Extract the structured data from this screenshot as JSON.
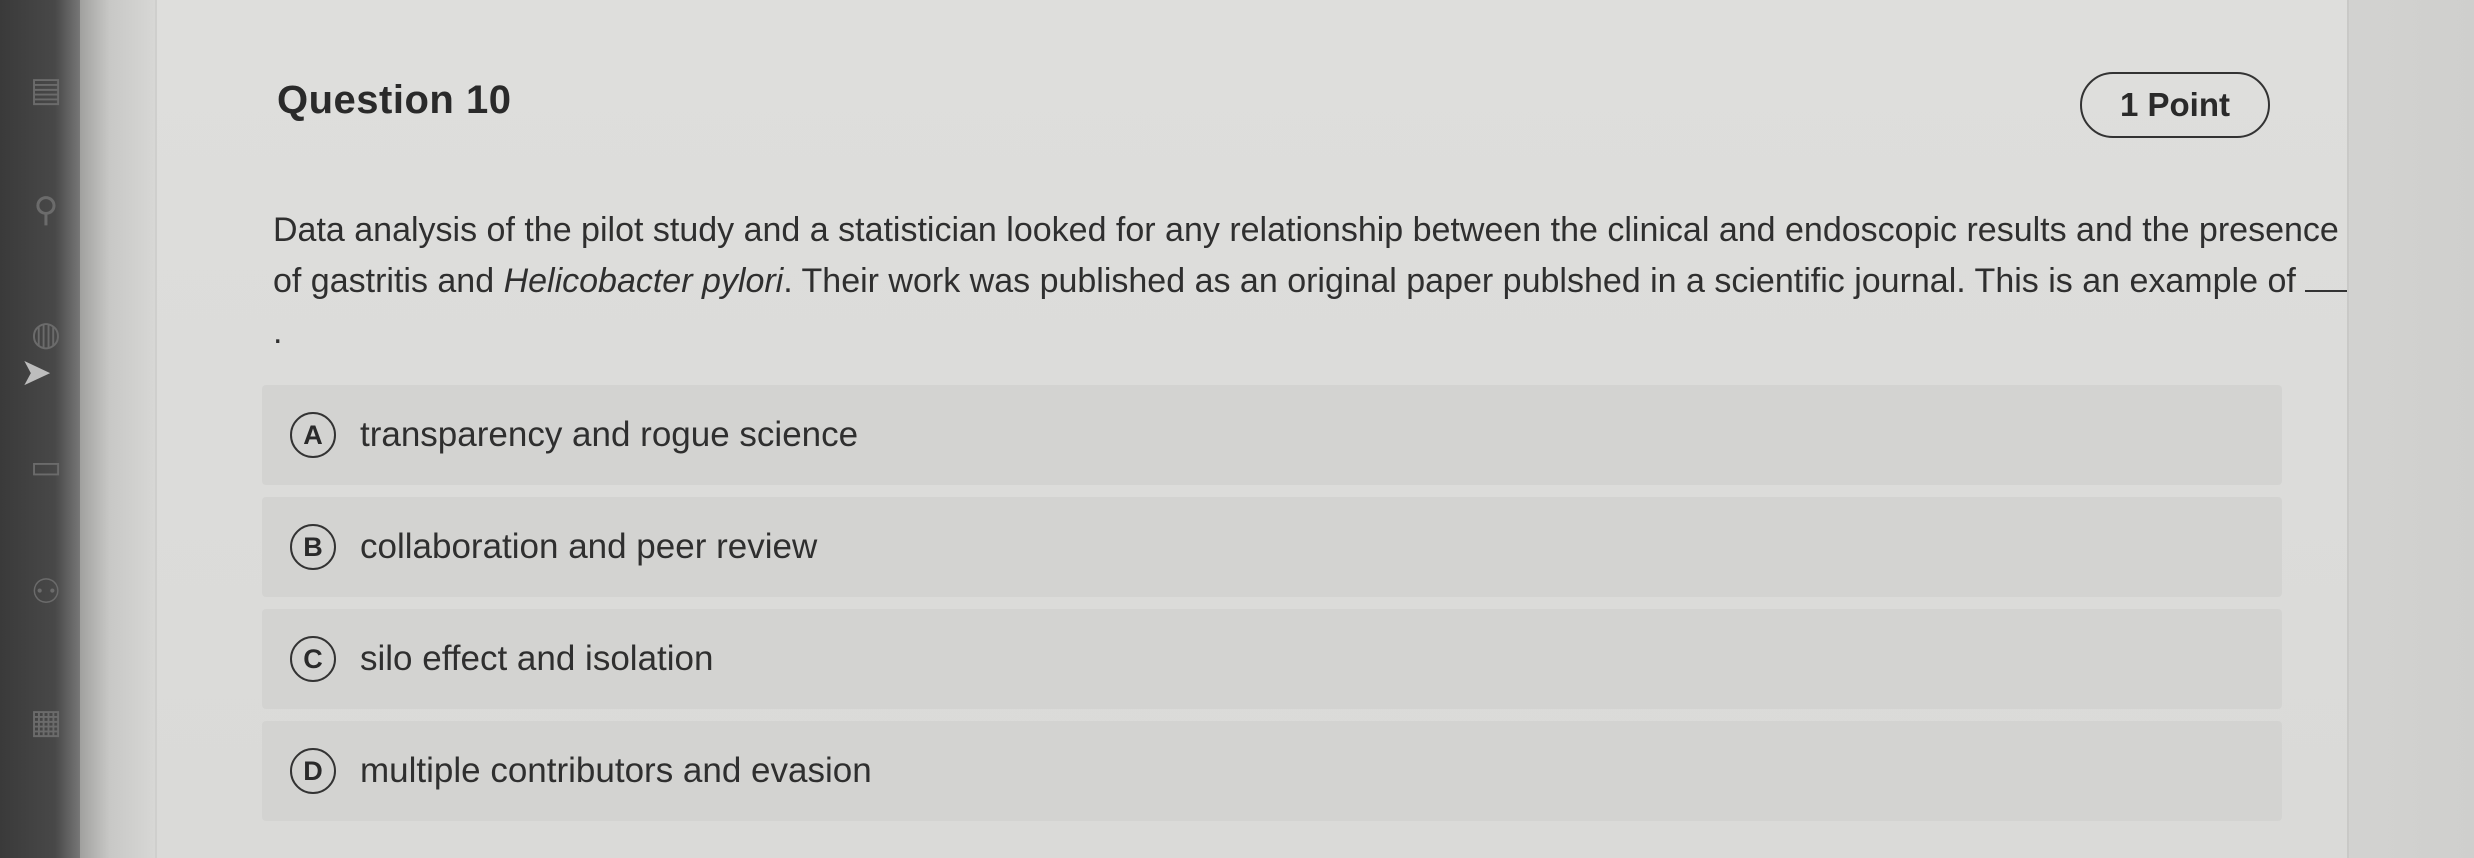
{
  "question": {
    "title": "Question 10",
    "points": "1 Point",
    "text_part1": "Data analysis of the pilot study and a statistician looked for any relationship between the clinical and endoscopic results and the presence of gastritis and ",
    "text_italic": "Helicobacter pylori",
    "text_part2": ". Their work was published as an original paper publshed in a scientific journal. This is an example of ",
    "text_end": "."
  },
  "options": [
    {
      "letter": "A",
      "label": "transparency and rogue science"
    },
    {
      "letter": "B",
      "label": "collaboration and peer review"
    },
    {
      "letter": "C",
      "label": "silo effect and isolation"
    },
    {
      "letter": "D",
      "label": "multiple contributors and evasion"
    }
  ],
  "sidebar": {
    "icons": [
      "book-icon",
      "search-icon",
      "globe-icon",
      "cursor-icon",
      "document-icon",
      "people-icon",
      "calculator-icon"
    ]
  }
}
